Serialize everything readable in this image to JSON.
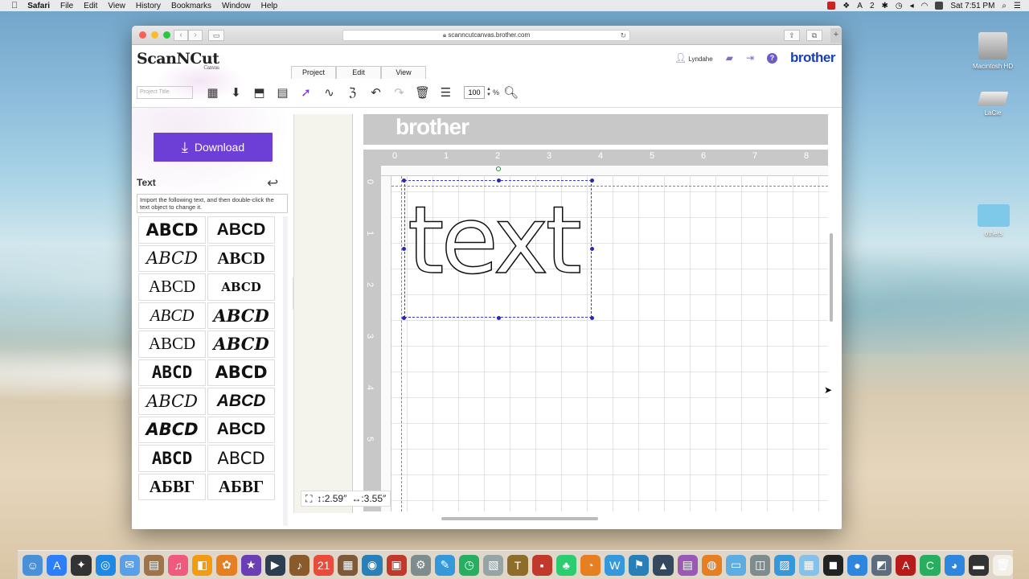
{
  "menubar": {
    "apple": "",
    "items": [
      "Safari",
      "File",
      "Edit",
      "View",
      "History",
      "Bookmarks",
      "Window",
      "Help"
    ],
    "battery_label": "2",
    "clock": "Sat 7:51 PM"
  },
  "browser": {
    "url": "scanncutcanvas.brother.com"
  },
  "app": {
    "logo": "ScanNCut",
    "logo_sub": "Canvas",
    "tabs": [
      "Project",
      "Edit",
      "View"
    ],
    "username": "Lyndahe",
    "brand": "brother",
    "project_title_placeholder": "Project Title",
    "zoom_value": "100",
    "zoom_unit": "%"
  },
  "left_panel": {
    "download_label": "Download",
    "title": "Text",
    "hint": "Import the following text, and then double-click the text object to change it.",
    "fonts": [
      {
        "sample": "ABCD",
        "style": "f1"
      },
      {
        "sample": "ABCD",
        "style": "f2"
      },
      {
        "sample": "ABCD",
        "style": "f3"
      },
      {
        "sample": "ABCD",
        "style": "f4"
      },
      {
        "sample": "ABCD",
        "style": "f5"
      },
      {
        "sample": "ABCD",
        "style": "f6"
      },
      {
        "sample": "ABCD",
        "style": "f7"
      },
      {
        "sample": "ABCD",
        "style": "f8"
      },
      {
        "sample": "ABCD",
        "style": "f5"
      },
      {
        "sample": "ABCD",
        "style": "f8"
      },
      {
        "sample": "ABCD",
        "style": "f9"
      },
      {
        "sample": "ABCD",
        "style": "f1"
      },
      {
        "sample": "ABCD",
        "style": "f3"
      },
      {
        "sample": "ABCD",
        "style": "fb"
      },
      {
        "sample": "ABCD",
        "style": "fa"
      },
      {
        "sample": "ABCD",
        "style": "f2"
      },
      {
        "sample": "ABCD",
        "style": "f9"
      },
      {
        "sample": "ABCD",
        "style": "fc"
      },
      {
        "sample": "АБВГ",
        "style": "f4"
      },
      {
        "sample": "АБВГ",
        "style": "f4"
      }
    ]
  },
  "canvas": {
    "mat_brand": "brother",
    "ruler_top": [
      "0",
      "1",
      "2",
      "3",
      "4",
      "5",
      "6",
      "7",
      "8"
    ],
    "ruler_left": [
      "0",
      "1",
      "2",
      "3",
      "4",
      "5"
    ],
    "text_object": "text",
    "dim_height": "↕:2.59″",
    "dim_width": "↔:3.55″"
  },
  "desktop": {
    "icons": [
      "Macintosh HD",
      "LaCie",
      "others"
    ]
  }
}
